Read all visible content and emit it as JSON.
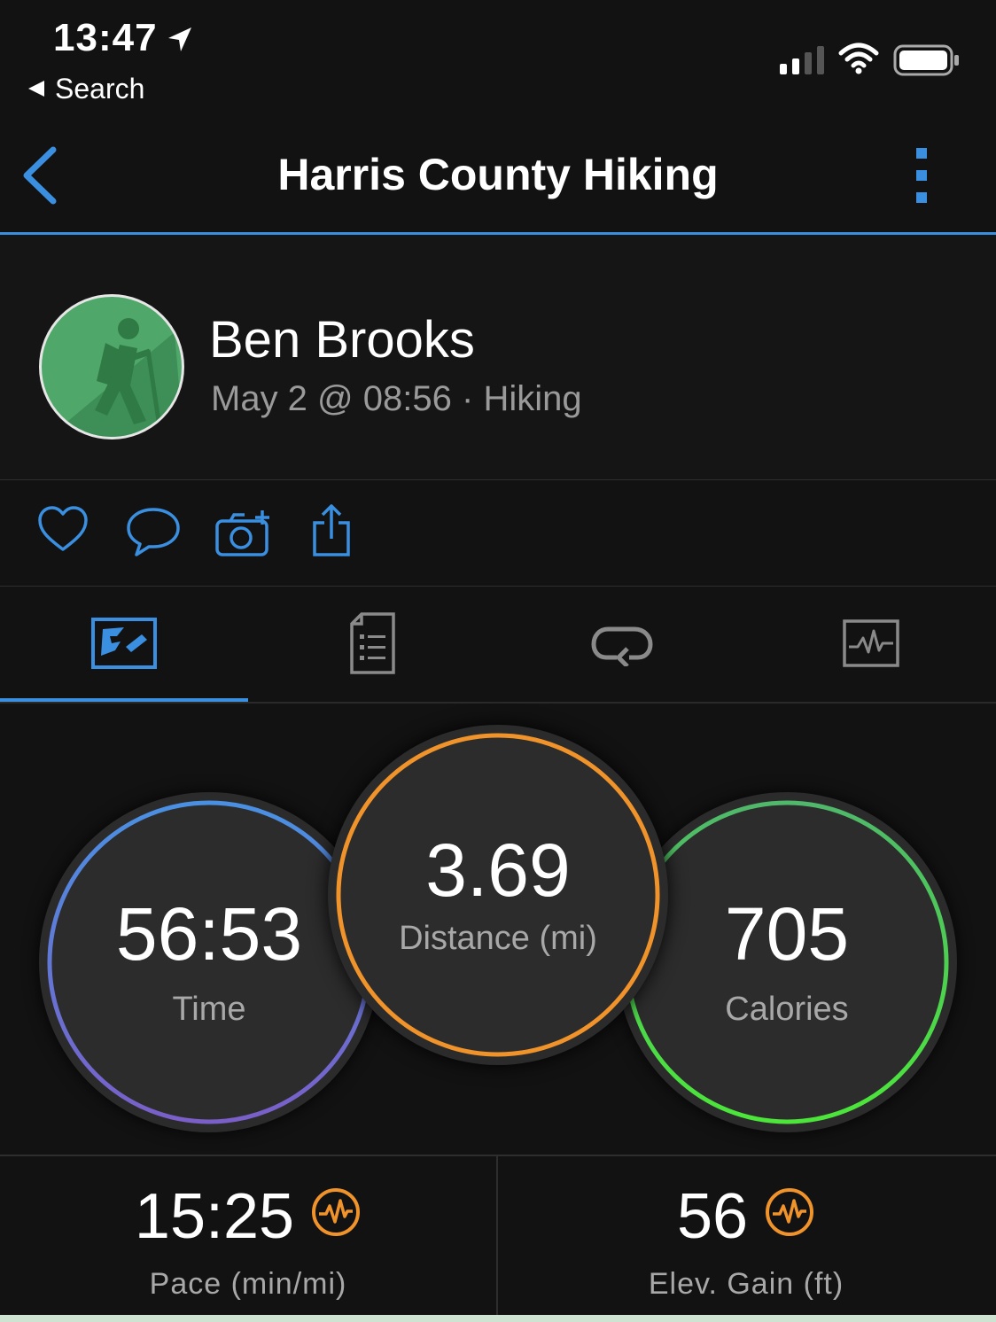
{
  "status_bar": {
    "time": "13:47",
    "back_label": "Search",
    "signal_bars": 4,
    "battery_level": 1.0
  },
  "nav": {
    "title": "Harris County Hiking"
  },
  "profile": {
    "name": "Ben Brooks",
    "date": "May 2 @ 08:56",
    "separator": "·",
    "activity": "Hiking"
  },
  "actions": [
    "heart-icon",
    "comment-icon",
    "add-photo-icon",
    "share-icon"
  ],
  "tabs": {
    "active_index": 0,
    "items": [
      "overview-tab-icon",
      "details-tab-icon",
      "laps-tab-icon",
      "charts-tab-icon"
    ]
  },
  "stats": {
    "time": {
      "value": "56:53",
      "label": "Time"
    },
    "distance": {
      "value": "3.69",
      "label": "Distance (mi)"
    },
    "calories": {
      "value": "705",
      "label": "Calories"
    }
  },
  "bottom_stats": {
    "pace": {
      "value": "15:25",
      "label": "Pace (min/mi)"
    },
    "elevation": {
      "value": "56",
      "label": "Elev. Gain (ft)"
    }
  },
  "colors": {
    "accent": "#3a8fe0",
    "time_ring_start": "#4a90e2",
    "time_ring_end": "#7a5fc8",
    "distance_ring": "#f0932b",
    "calories_ring_start": "#4fb86a",
    "calories_ring_end": "#4ce63a",
    "chart_badge": "#f0932b",
    "avatar_bg": "#4fa86a"
  }
}
